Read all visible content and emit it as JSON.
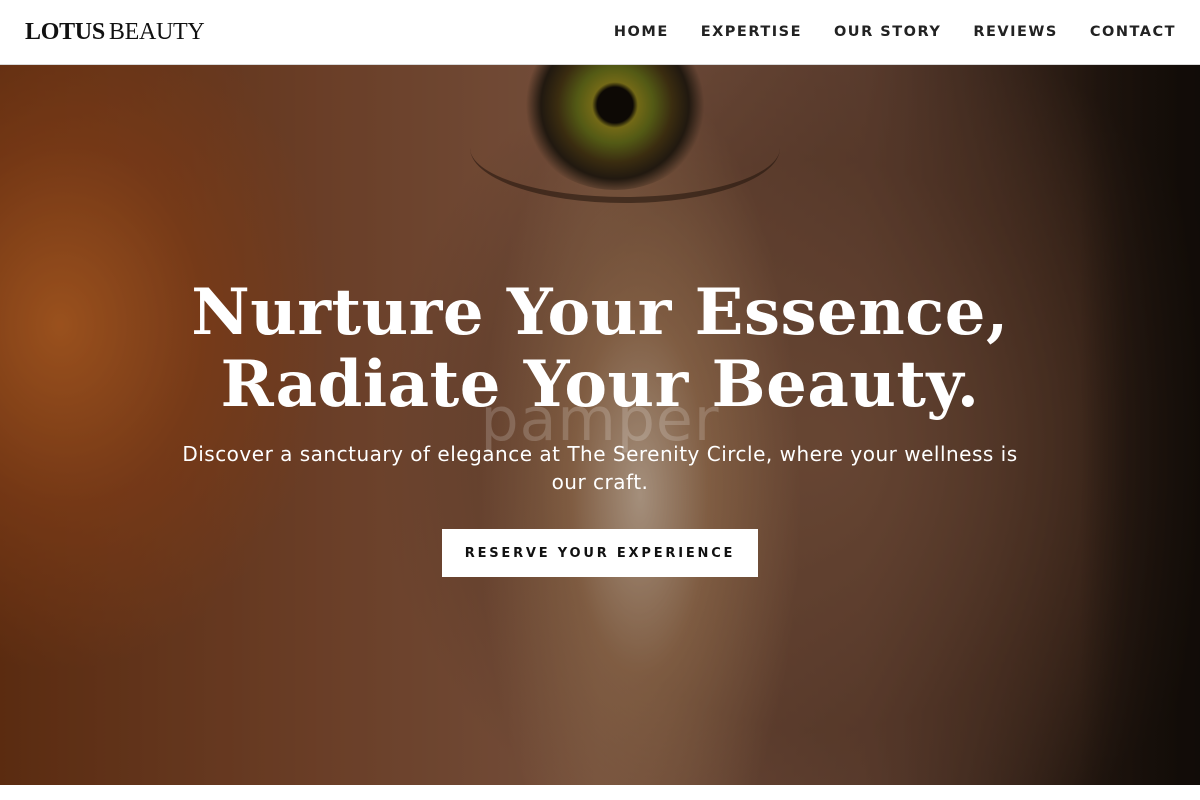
{
  "brand": {
    "name_bold": "LOTUS",
    "name_light": "BEAUTY"
  },
  "nav": {
    "items": [
      {
        "label": "HOME"
      },
      {
        "label": "EXPERTISE"
      },
      {
        "label": "OUR STORY"
      },
      {
        "label": "REVIEWS"
      },
      {
        "label": "CONTACT"
      }
    ]
  },
  "hero": {
    "headline_line1": "Nurture Your Essence,",
    "headline_line2": "Radiate Your Beauty.",
    "background_watermark": "pamper",
    "subtext": "Discover a sanctuary of elegance at The Serenity Circle, where your wellness is our craft.",
    "cta_label": "RESERVE YOUR EXPERIENCE",
    "background_image": "close-up-face-eye-light-beam"
  },
  "colors": {
    "header_bg": "#ffffff",
    "nav_text": "#222222",
    "hero_text": "#ffffff",
    "cta_bg": "#ffffff",
    "cta_text": "#111111"
  }
}
